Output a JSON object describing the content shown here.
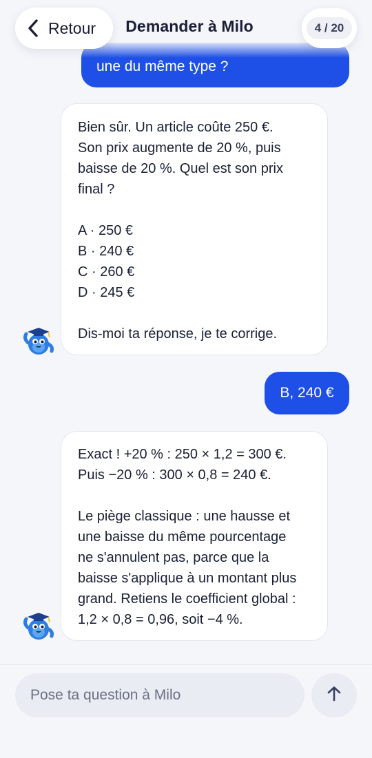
{
  "header": {
    "back_label": "Retour",
    "title": "Demander à Milo",
    "counter": "4 / 20"
  },
  "messages": [
    {
      "role": "user",
      "lines": [
        "une du même type ?"
      ]
    },
    {
      "role": "assistant",
      "paragraphs": [
        [
          "Bien sûr. Un article coûte 250 €.",
          "Son prix augmente de 20 %, puis",
          "baisse de 20 %. Quel est son prix",
          "final ?"
        ],
        [
          "A · 250 €",
          "B · 240 €",
          "C · 260 €",
          "D · 245 €"
        ],
        [
          "Dis-moi ta réponse, je te corrige."
        ]
      ]
    },
    {
      "role": "user",
      "lines": [
        "B, 240 €"
      ]
    },
    {
      "role": "assistant",
      "paragraphs": [
        [
          "Exact ! +20 % : 250 × 1,2 = 300 €.",
          "Puis −20 % : 300 × 0,8 = 240 €."
        ],
        [
          "Le piège classique : une hausse et",
          "une baisse du même pourcentage",
          "ne s'annulent pas, parce que la",
          "baisse s'applique à un montant plus",
          "grand. Retiens le coefficient global :",
          "1,2 × 0,8 = 0,96, soit −4 %."
        ]
      ]
    }
  ],
  "composer": {
    "placeholder": "Pose ta question à Milo",
    "value": ""
  },
  "icons": {
    "back": "chevron-left-icon",
    "send": "arrow-up-icon",
    "avatar": "milo-mascot-icon"
  },
  "colors": {
    "accent": "#1e4fe6",
    "background": "#f5f6fa"
  }
}
